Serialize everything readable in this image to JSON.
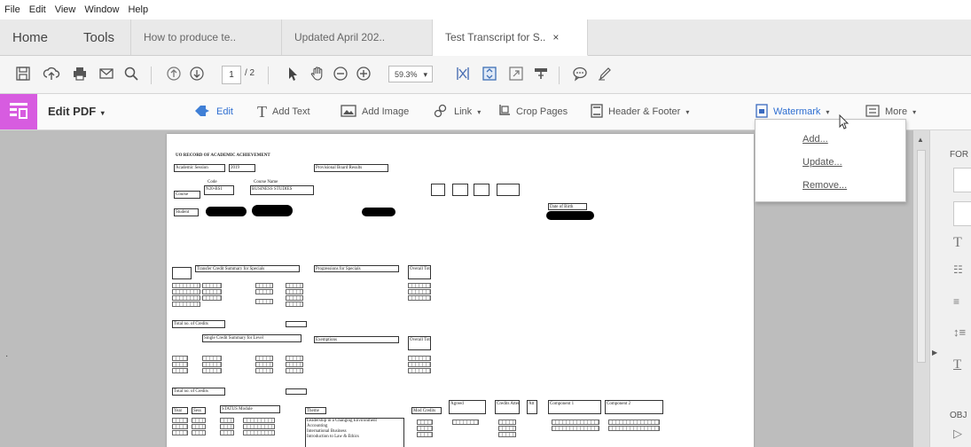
{
  "menu": [
    "File",
    "Edit",
    "View",
    "Window",
    "Help"
  ],
  "tabs": {
    "home": "Home",
    "tools": "Tools",
    "documents": [
      {
        "label": "How to produce te..",
        "active": false
      },
      {
        "label": "Updated April 202..",
        "active": false
      },
      {
        "label": "Test Transcript for S..",
        "active": true
      }
    ],
    "close_glyph": "×"
  },
  "toolbar": {
    "page_current": "1",
    "page_total": "/ 2",
    "zoom": "59.3%",
    "zoom_caret": "▾"
  },
  "edit_toolbar": {
    "title": "Edit PDF",
    "title_caret": "▾",
    "caret": "▾",
    "edit": "Edit",
    "add_text": "Add Text",
    "add_image": "Add Image",
    "link": "Link",
    "crop_pages": "Crop Pages",
    "header_footer": "Header & Footer",
    "watermark": "Watermark",
    "more": "More"
  },
  "watermark_menu": {
    "items": [
      "Add...",
      "Update...",
      "Remove..."
    ]
  },
  "right_panel": {
    "format_label": "FOR",
    "objects_label": "OBJ"
  },
  "transcript": {
    "heading": "UO RECORD OF ACADEMIC ACHIEVEMENT",
    "academic_session_label": "Academic Session",
    "academic_session_value": "2019",
    "provisional": "Provisional Board Results",
    "course_label": "Course",
    "code_label": "Code",
    "code_value": "N20-BS1",
    "course_name_label": "Course Name",
    "course_name_value": "BUSINESS STUDIES",
    "student_label": "Student",
    "date_of_birth": "Date of Birth",
    "transfer_head_1": "Transfer Credit Summary for Specials",
    "transfer_head_2": "Progressions for Specials",
    "transfer_total": "Overall Total",
    "total_credits_1": "Total no. of Credits",
    "single_credit_head": "Single Credit Summary for Level",
    "exemptions_head": "Exemptions",
    "overall_2": "Overall Total",
    "total_credits_2": "Total no. of Credits",
    "status_modules": "STATUS Module",
    "theme_label": "Theme",
    "module_rows": [
      "Leadership in a Changing Environment",
      "Accounting",
      "International Business",
      "Introduction to Law & Ethics"
    ],
    "col_headers": [
      "Year",
      "Sess",
      "Mod Credits",
      "Agreed",
      "Credits Attempt",
      "Att",
      "Component 1",
      "Component 2"
    ]
  }
}
